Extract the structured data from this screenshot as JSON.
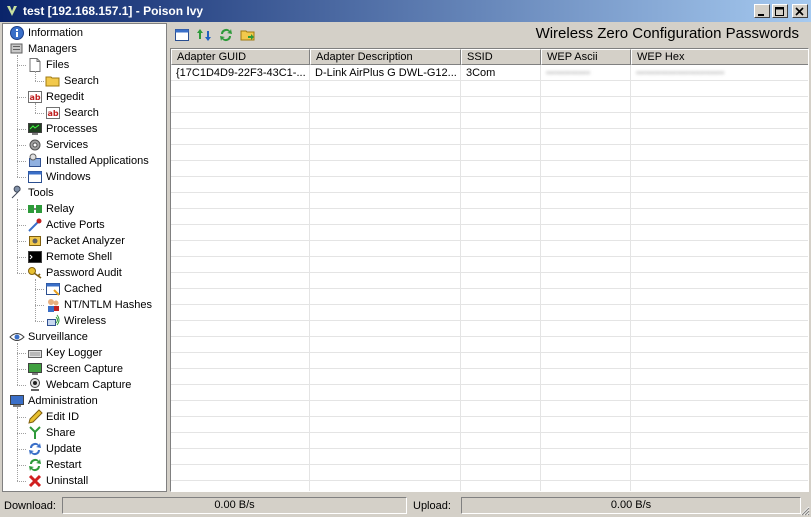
{
  "window": {
    "title": "test [192.168.157.1] - Poison Ivy",
    "minimize_label": "minimize",
    "maximize_label": "maximize",
    "close_label": "close"
  },
  "tree": [
    {
      "id": "information",
      "label": "Information",
      "icon": "info-icon",
      "level": 0
    },
    {
      "id": "managers",
      "label": "Managers",
      "icon": "managers-icon",
      "level": 0
    },
    {
      "id": "files",
      "label": "Files",
      "icon": "file-icon",
      "level": 1
    },
    {
      "id": "files-search",
      "label": "Search",
      "icon": "folder-search-icon",
      "level": 2
    },
    {
      "id": "regedit",
      "label": "Regedit",
      "icon": "registry-icon",
      "level": 1
    },
    {
      "id": "regedit-search",
      "label": "Search",
      "icon": "registry-search-icon",
      "level": 2
    },
    {
      "id": "processes",
      "label": "Processes",
      "icon": "processes-icon",
      "level": 1
    },
    {
      "id": "services",
      "label": "Services",
      "icon": "gear-icon",
      "level": 1
    },
    {
      "id": "installed-applications",
      "label": "Installed Applications",
      "icon": "installer-icon",
      "level": 1
    },
    {
      "id": "windows",
      "label": "Windows",
      "icon": "window-icon",
      "level": 1
    },
    {
      "id": "tools",
      "label": "Tools",
      "icon": "wrench-icon",
      "level": 0
    },
    {
      "id": "relay",
      "label": "Relay",
      "icon": "relay-icon",
      "level": 1
    },
    {
      "id": "active-ports",
      "label": "Active Ports",
      "icon": "ports-icon",
      "level": 1
    },
    {
      "id": "packet-analyzer",
      "label": "Packet Analyzer",
      "icon": "packet-icon",
      "level": 1
    },
    {
      "id": "remote-shell",
      "label": "Remote Shell",
      "icon": "terminal-icon",
      "level": 1
    },
    {
      "id": "password-audit",
      "label": "Password Audit",
      "icon": "key-icon",
      "level": 1
    },
    {
      "id": "cached",
      "label": "Cached",
      "icon": "cached-icon",
      "level": 2
    },
    {
      "id": "nt-ntlm-hashes",
      "label": "NT/NTLM Hashes",
      "icon": "users-icon",
      "level": 2
    },
    {
      "id": "wireless",
      "label": "Wireless",
      "icon": "wireless-icon",
      "level": 2
    },
    {
      "id": "surveillance",
      "label": "Surveillance",
      "icon": "eye-icon",
      "level": 0
    },
    {
      "id": "key-logger",
      "label": "Key Logger",
      "icon": "keyboard-icon",
      "level": 1
    },
    {
      "id": "screen-capture",
      "label": "Screen Capture",
      "icon": "screen-icon",
      "level": 1
    },
    {
      "id": "webcam-capture",
      "label": "Webcam Capture",
      "icon": "webcam-icon",
      "level": 1
    },
    {
      "id": "administration",
      "label": "Administration",
      "icon": "computer-icon",
      "level": 0
    },
    {
      "id": "edit-id",
      "label": "Edit ID",
      "icon": "pencil-icon",
      "level": 1
    },
    {
      "id": "share",
      "label": "Share",
      "icon": "share-icon",
      "level": 1
    },
    {
      "id": "update",
      "label": "Update",
      "icon": "update-icon",
      "level": 1
    },
    {
      "id": "restart",
      "label": "Restart",
      "icon": "restart-icon",
      "level": 1
    },
    {
      "id": "uninstall",
      "label": "Uninstall",
      "icon": "uninstall-icon",
      "level": 1
    }
  ],
  "panel": {
    "title": "Wireless Zero Configuration Passwords",
    "toolbar": [
      {
        "id": "view",
        "icon": "window-icon"
      },
      {
        "id": "transfer",
        "icon": "transfer-arrows-icon"
      },
      {
        "id": "refresh",
        "icon": "refresh-icon"
      },
      {
        "id": "save",
        "icon": "save-folder-icon"
      }
    ],
    "columns": [
      "Adapter GUID",
      "Adapter Description",
      "SSID",
      "WEP Ascii",
      "WEP Hex"
    ],
    "rows": [
      {
        "adapter_guid": "{17C1D4D9-22F3-43C1-...",
        "adapter_description": "D-Link AirPlus G DWL-G12...",
        "ssid": "3Com",
        "wep_ascii": "••••••••••••••",
        "wep_hex": "••••••••••••••••••••••••••••"
      }
    ]
  },
  "status": {
    "download_label": "Download:",
    "download_value": "0.00 B/s",
    "upload_label": "Upload:",
    "upload_value": "0.00 B/s"
  }
}
